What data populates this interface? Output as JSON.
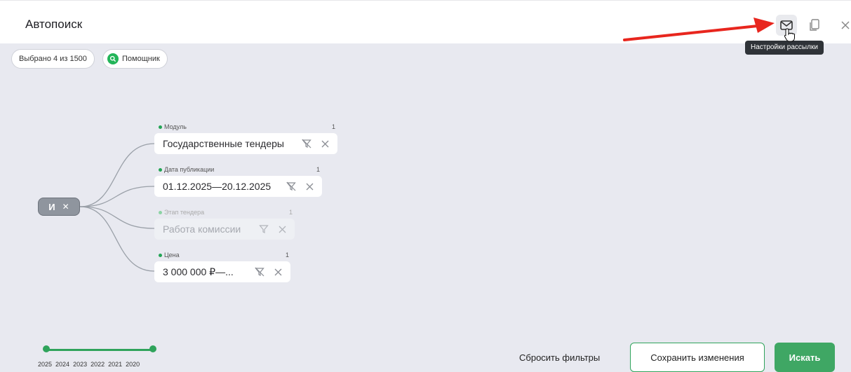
{
  "window": {
    "title": "Автопоиск",
    "icons": [
      "more-dots-icon",
      "mail-icon",
      "copy-icon",
      "close-icon"
    ],
    "tooltip": "Настройки рассылки"
  },
  "toolbar": {
    "selected_label": "Выбрано 4 из 1500",
    "helper_label": "Помощник"
  },
  "tree": {
    "root_label": "И",
    "filters": [
      {
        "label": "Модуль",
        "count": "1",
        "value": "Государственные тендеры",
        "disabled": false
      },
      {
        "label": "Дата публикации",
        "count": "1",
        "value": "01.12.2025—20.12.2025",
        "disabled": false
      },
      {
        "label": "Этап тендера",
        "count": "1",
        "value": "Работа комиссии",
        "disabled": true
      },
      {
        "label": "Цена",
        "count": "1",
        "value": "3 000 000 ₽—...",
        "disabled": false
      }
    ]
  },
  "timeline": {
    "years": [
      "2025",
      "2024",
      "2023",
      "2022",
      "2021",
      "2020"
    ]
  },
  "actions": {
    "reset_label": "Сбросить фильтры",
    "save_label": "Сохранить изменения",
    "search_label": "Искать"
  },
  "colors": {
    "accent_green": "#2fa35b",
    "annotation_arrow": "#e8261e",
    "canvas_bg": "#e8e9f0"
  }
}
